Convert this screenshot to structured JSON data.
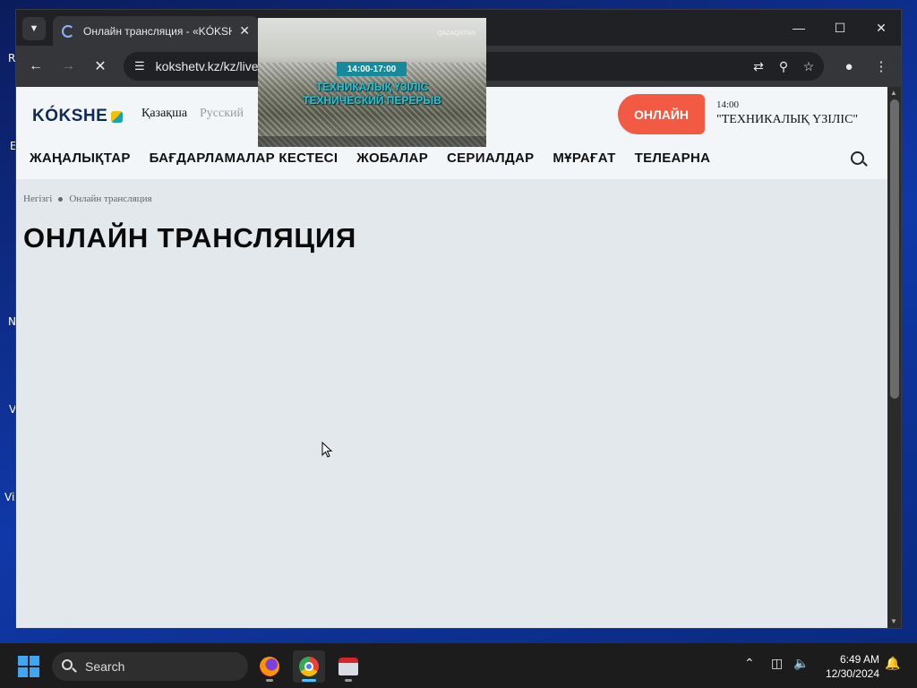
{
  "desktop": {
    "icon_labels": [
      "R",
      "E",
      "N",
      "V",
      "Vis"
    ]
  },
  "browser": {
    "tab": {
      "title": "Онлайн трансляция - «KÓKSHE",
      "close_glyph": "✕"
    },
    "window_controls": {
      "minimize": "—",
      "maximize": "☐",
      "close": "✕"
    },
    "toolbar": {
      "back": "←",
      "forward": "→",
      "reload": "✕",
      "url": "kokshetv.kz/kz/live"
    }
  },
  "site": {
    "logo_text": "KÓKSHE",
    "lang_kz": "Қазақша",
    "lang_ru": "Русский",
    "online_button": "ОНЛАЙН",
    "now_playing": {
      "time": "14:00",
      "title": "\"ТЕХНИКАЛЫҚ ҮЗІЛІС\""
    },
    "nav": [
      "ЖАҢАЛЫҚТАР",
      "БАҒДАРЛАМАЛАР КЕСТЕСІ",
      "ЖОБАЛАР",
      "СЕРИАЛДАР",
      "МҰРАҒАТ",
      "ТЕЛЕАРНА"
    ],
    "breadcrumb": [
      "Негізгі",
      "Онлайн трансляция"
    ],
    "page_title": "ОНЛАЙН ТРАНСЛЯЦИЯ"
  },
  "preview": {
    "channel_label": "QAZAQSTAN",
    "time_range": "14:00-17:00",
    "line1": "ТЕХНИКАЛЫҚ ҮЗІЛІС",
    "line2": "ТЕХНИЧЕСКИЙ ПЕРЕРЫВ"
  },
  "taskbar": {
    "search_label": "Search",
    "time": "6:49 AM",
    "date": "12/30/2024"
  },
  "colors": {
    "accent_online": "#f35a43",
    "page_background": "#e2e8ec",
    "preview_caption": "#2cc1d3",
    "preview_time_bg": "#16899a"
  }
}
